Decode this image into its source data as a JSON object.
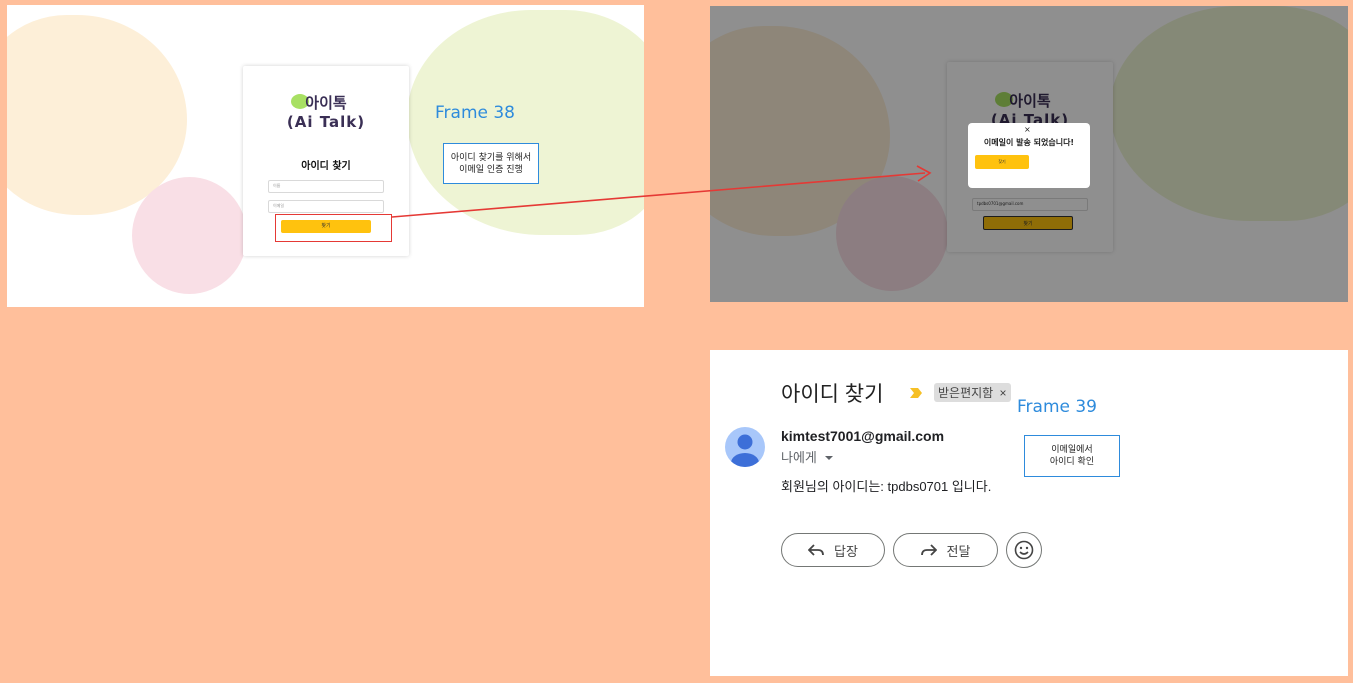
{
  "frame1": {
    "logo_line1": "아이톡",
    "logo_line2": "(Ai Talk)",
    "title": "아이디 찾기",
    "name_placeholder": "이름",
    "email_placeholder": "이메일",
    "find_button": "찾기",
    "label": "Frame 38",
    "note": "아이디 찾기를 위해서\n이메일 인증 진행"
  },
  "frame2": {
    "logo_line1": "아이톡",
    "logo_line2": "(Ai Talk)",
    "modal_close": "×",
    "modal_message": "이메일이 발송 되었습니다!",
    "modal_button": "찾기",
    "email_value": "tpdbs0701@gmail.com",
    "find_button": "찾기"
  },
  "frame3": {
    "subject": "아이디 찾기",
    "inbox_chip": "받은편지함",
    "chip_close": "×",
    "label": "Frame 39",
    "sender": "kimtest7001@gmail.com",
    "to_me": "나에게",
    "body": "회원님의 아이디는: tpdbs0701 입니다.",
    "reply": "답장",
    "forward": "전달",
    "note": "이메일에서\n아이디 확인"
  },
  "colors": {
    "background": "#ffbf9b",
    "accent_yellow": "#ffc20e",
    "label_blue": "#2e8bdc",
    "arrow_red": "#e53935"
  },
  "icons": [
    "label-arrow-icon",
    "chevron-down-icon",
    "reply-icon",
    "forward-icon",
    "emoji-icon",
    "avatar-person-icon"
  ]
}
